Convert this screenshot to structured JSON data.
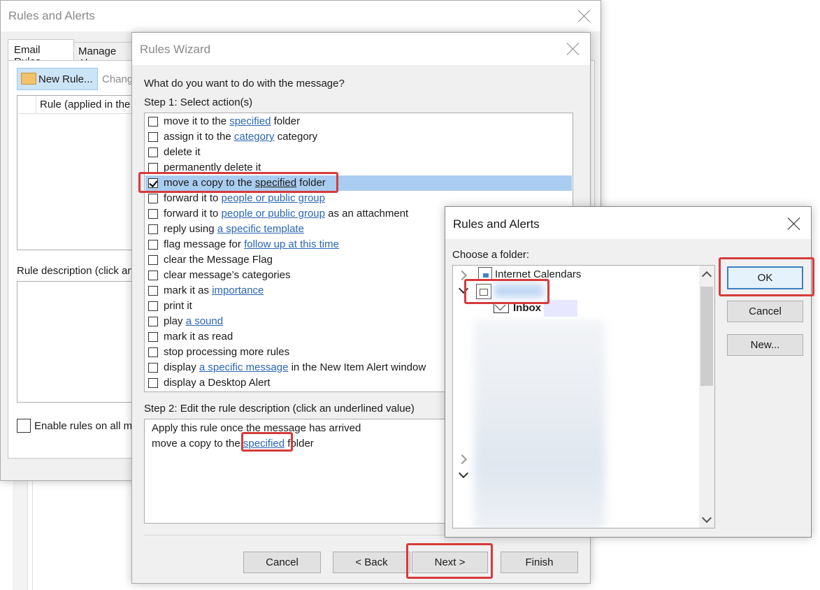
{
  "back_dialog": {
    "title": "Rules and Alerts",
    "tabs": [
      "Email Rules",
      "Manage Ale"
    ],
    "new_rule_label": "New Rule...",
    "change_label": "Chang",
    "rule_column": "Rule (applied in the",
    "rule_description_label": "Rule description (click an",
    "enable_rules_label": "Enable rules on all m"
  },
  "wizard": {
    "title": "Rules Wizard",
    "question": "What do you want to do with the message?",
    "step1": "Step 1: Select action(s)",
    "actions": [
      {
        "pre": "move it to the ",
        "link": "specified",
        "post": " folder",
        "checked": false
      },
      {
        "pre": "assign it to the ",
        "link": "category",
        "post": " category",
        "checked": false
      },
      {
        "pre": "delete it",
        "link": "",
        "post": "",
        "checked": false
      },
      {
        "pre": "permanently delete it",
        "link": "",
        "post": "",
        "checked": false
      },
      {
        "pre": "move a copy to the ",
        "link": "specified",
        "post": " folder",
        "checked": true
      },
      {
        "pre": "forward it to ",
        "link": "people or public group",
        "post": "",
        "checked": false
      },
      {
        "pre": "forward it to ",
        "link": "people or public group",
        "post": " as an attachment",
        "checked": false
      },
      {
        "pre": "reply using ",
        "link": "a specific template",
        "post": "",
        "checked": false
      },
      {
        "pre": "flag message for ",
        "link": "follow up at this time",
        "post": "",
        "checked": false
      },
      {
        "pre": "clear the Message Flag",
        "link": "",
        "post": "",
        "checked": false
      },
      {
        "pre": "clear message’s categories",
        "link": "",
        "post": "",
        "checked": false
      },
      {
        "pre": "mark it as ",
        "link": "importance",
        "post": "",
        "checked": false
      },
      {
        "pre": "print it",
        "link": "",
        "post": "",
        "checked": false
      },
      {
        "pre": "play ",
        "link": "a sound",
        "post": "",
        "checked": false
      },
      {
        "pre": "mark it as read",
        "link": "",
        "post": "",
        "checked": false
      },
      {
        "pre": "stop processing more rules",
        "link": "",
        "post": "",
        "checked": false
      },
      {
        "pre": "display ",
        "link": "a specific message",
        "post": " in the New Item Alert window",
        "checked": false
      },
      {
        "pre": "display a Desktop Alert",
        "link": "",
        "post": "",
        "checked": false
      }
    ],
    "step2": "Step 2: Edit the rule description (click an underlined value)",
    "desc_line1": "Apply this rule once the message has arrived",
    "desc_line2_pre": "move a copy to the ",
    "desc_line2_link": "specified",
    "desc_line2_post": " folder",
    "buttons": {
      "cancel": "Cancel",
      "back": "< Back",
      "next": "Next >",
      "finish": "Finish"
    }
  },
  "folder_dialog": {
    "title": "Rules and Alerts",
    "choose_label": "Choose a folder:",
    "tree": {
      "internet_calendars": "Internet Calendars",
      "inbox": "Inbox"
    },
    "buttons": {
      "ok": "OK",
      "cancel": "Cancel",
      "new": "New..."
    }
  },
  "colors": {
    "highlight": "#d63b3b",
    "link": "#2a66b5",
    "selection": "#a9cdf0"
  }
}
